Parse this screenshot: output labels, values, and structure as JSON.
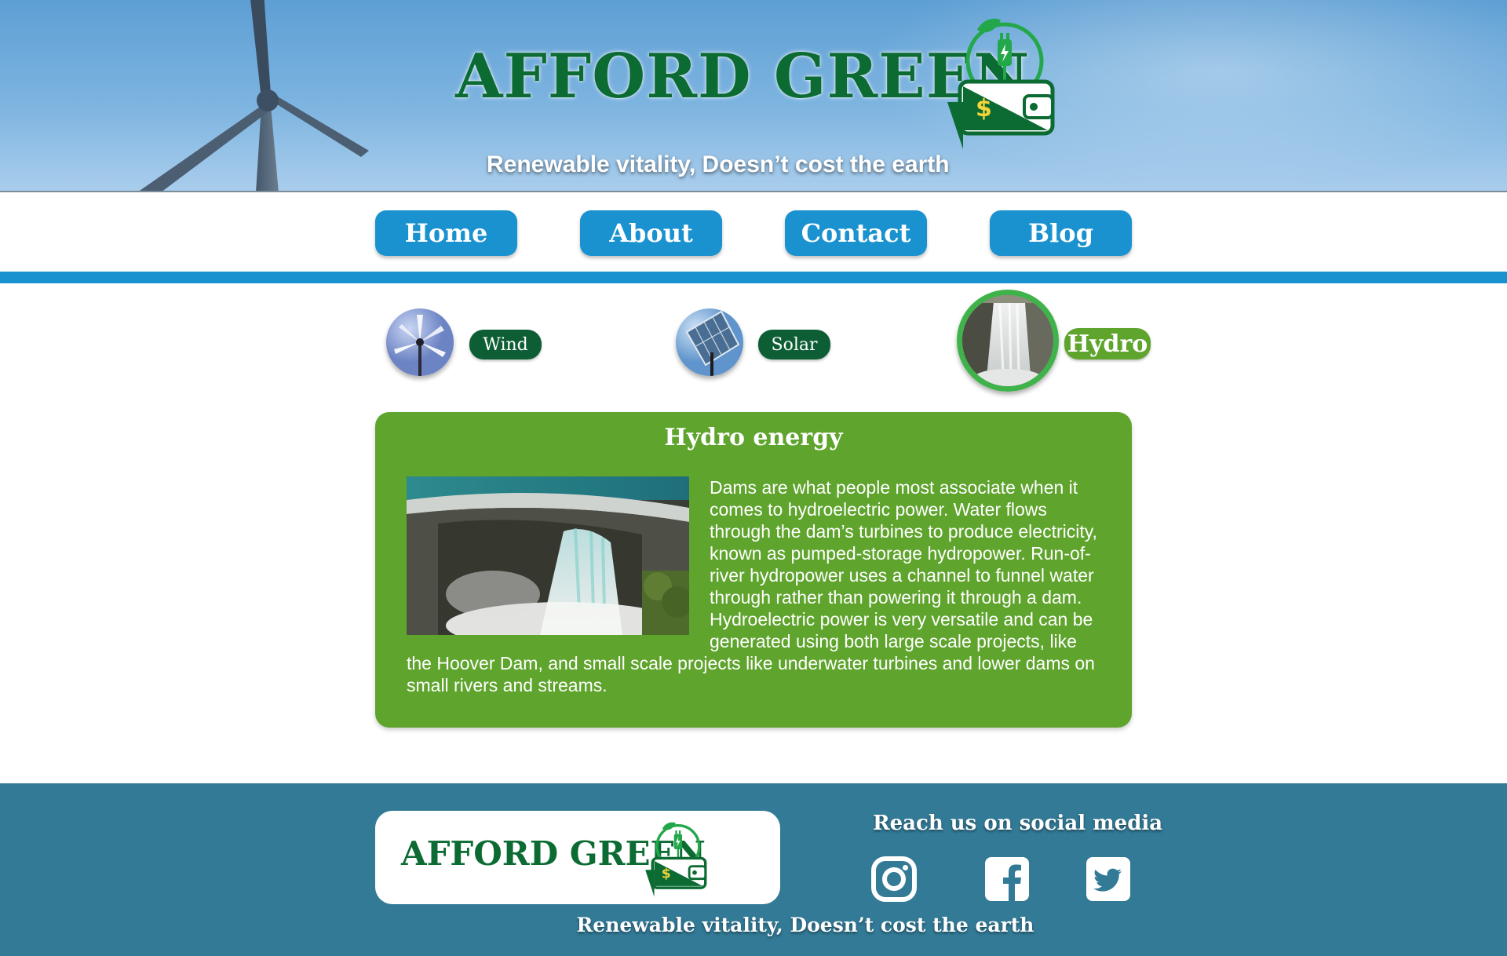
{
  "header": {
    "brand": "AFFORD GREEN",
    "tagline": "Renewable vitality, Doesn’t cost the earth"
  },
  "nav": {
    "items": [
      {
        "label": "Home"
      },
      {
        "label": "About"
      },
      {
        "label": "Contact"
      },
      {
        "label": "Blog"
      }
    ]
  },
  "energy_tabs": {
    "items": [
      {
        "label": "Wind",
        "active": false
      },
      {
        "label": "Solar",
        "active": false
      },
      {
        "label": "Hydro",
        "active": true
      }
    ]
  },
  "content": {
    "title": "Hydro energy",
    "body": "Dams are what people most associate when it comes to hydroelectric power. Water flows through the dam’s turbines to produce electricity, known as pumped-storage hydropower. Run-of-river hydropower uses a channel to funnel water through rather than powering it through a dam. Hydroelectric power is very versatile and can be generated using both large scale projects, like the Hoover Dam, and small scale projects like underwater turbines and lower dams on small rivers and streams."
  },
  "footer": {
    "brand": "AFFORD GREEN",
    "social_heading": "Reach us on social media",
    "social_icons": [
      "instagram-icon",
      "facebook-icon",
      "twitter-icon"
    ],
    "tagline": "Renewable vitality, Doesn’t cost the earth"
  },
  "colors": {
    "brand_green": "#0b6b33",
    "nav_blue": "#1992cf",
    "card_green": "#5fa42d",
    "footer_teal": "#327a96"
  }
}
